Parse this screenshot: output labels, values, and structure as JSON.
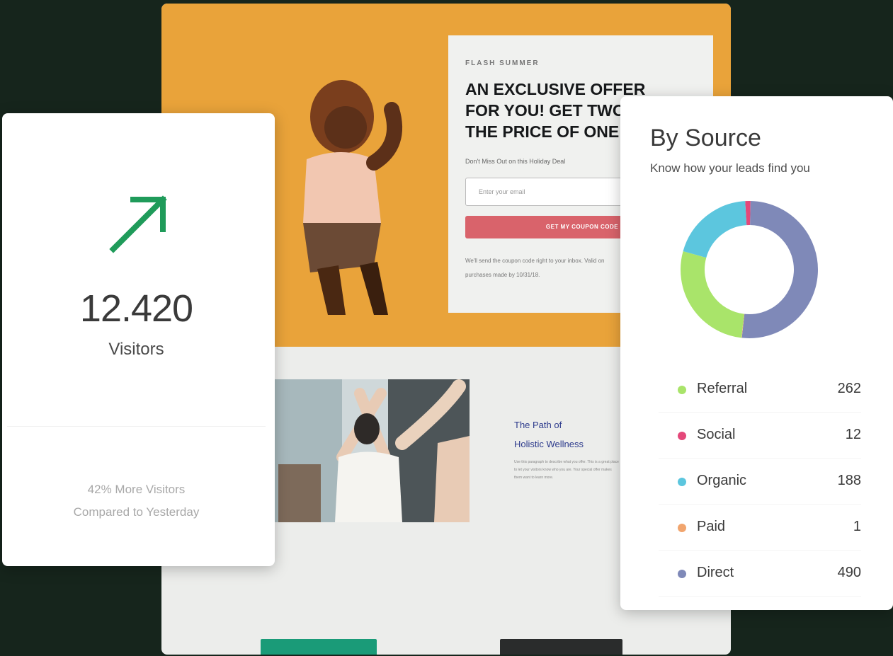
{
  "landing": {
    "eyebrow": "FLASH SUMMER",
    "headline": "AN EXCLUSIVE OFFER\nFOR YOU! GET TWO FOR\nTHE PRICE OF ONE",
    "subtext": "Don't Miss Out on this Holiday Deal",
    "email_placeholder": "Enter your email",
    "cta_label": "GET MY COUPON CODE",
    "note": "We'll send the coupon code right to your inbox. Valid on purchases made by 10/31/18.",
    "hero_color": "#e9a33a",
    "cta_color": "#d9636b",
    "wellness_title": "The Path of\nHolistic Wellness",
    "wellness_body": "Use this paragraph to describe what you offer. This is a great place to let your visitors know who you are. Your special offer makes them want to learn more.",
    "button_colors": [
      "#1a9b78",
      "#2a2c2c"
    ]
  },
  "visitors": {
    "trend_icon": "arrow-up-right-icon",
    "trend_color": "#1f9b5a",
    "value": "12.420",
    "label": "Visitors",
    "compare": "42% More Visitors\nCompared to Yesterday"
  },
  "by_source": {
    "title": "By Source",
    "subtitle": "Know how your leads find you",
    "items": [
      {
        "name": "Referral",
        "count": "262",
        "color": "#a9e46a"
      },
      {
        "name": "Social",
        "count": "12",
        "color": "#e4487a"
      },
      {
        "name": "Organic",
        "count": "188",
        "color": "#5cc6de"
      },
      {
        "name": "Paid",
        "count": "1",
        "color": "#f1a56e"
      },
      {
        "name": "Direct",
        "count": "490",
        "color": "#7f89b8"
      }
    ]
  }
}
